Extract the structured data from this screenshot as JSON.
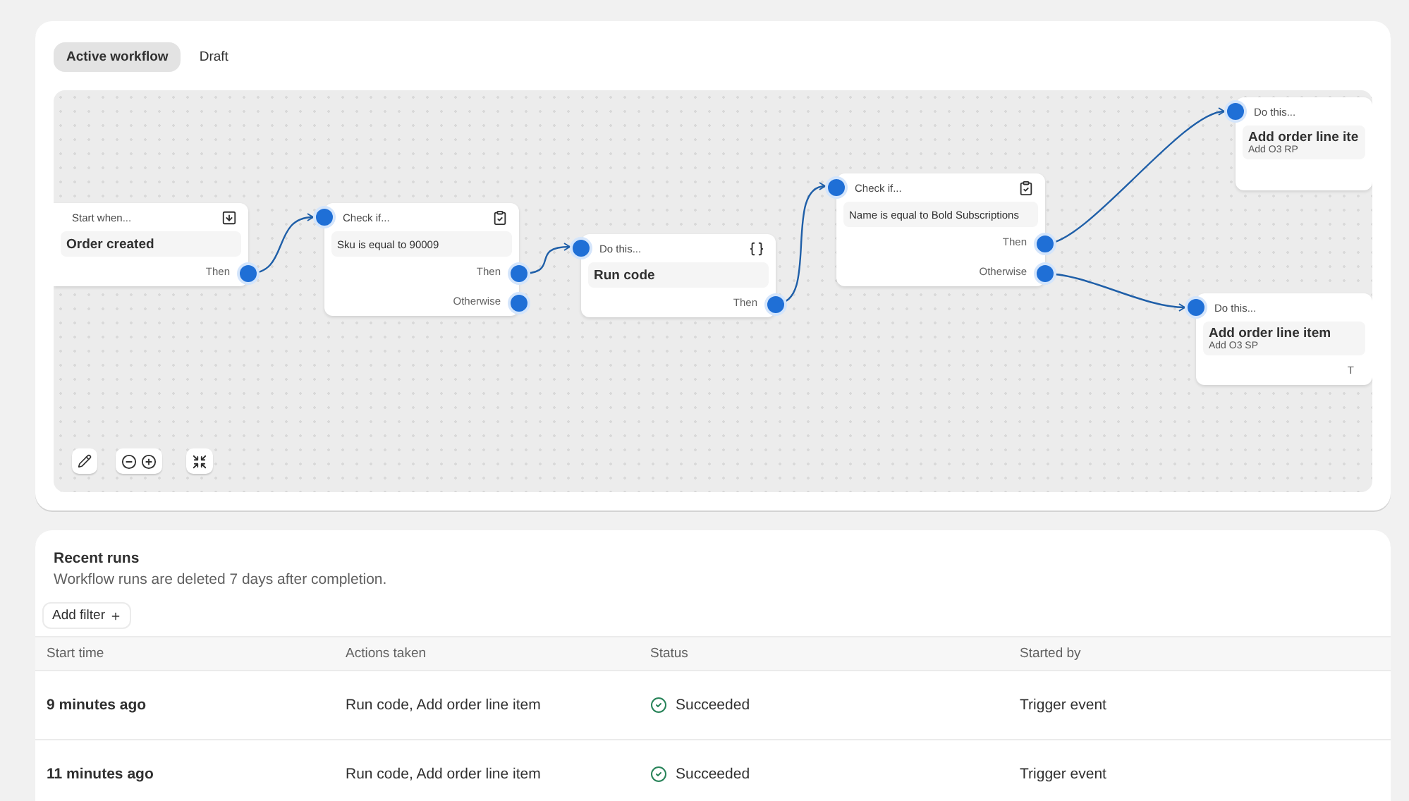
{
  "tabs": [
    {
      "label": "Active workflow",
      "selected": true
    },
    {
      "label": "Draft",
      "selected": false
    }
  ],
  "canvas": {
    "nodes": [
      {
        "kind": "trigger",
        "header": "Start when...",
        "title": "Order created",
        "outputs": [
          "Then"
        ]
      },
      {
        "kind": "condition",
        "header": "Check if...",
        "title": "Sku is equal to 90009",
        "outputs": [
          "Then",
          "Otherwise"
        ]
      },
      {
        "kind": "code",
        "header": "Do this...",
        "title": "Run code",
        "outputs": [
          "Then"
        ]
      },
      {
        "kind": "condition",
        "header": "Check if...",
        "title": "Name is equal to Bold Subscriptions",
        "outputs": [
          "Then",
          "Otherwise"
        ]
      },
      {
        "kind": "action",
        "header": "Do this...",
        "title": "Add order line ite",
        "subtitle": "Add O3 RP"
      },
      {
        "kind": "action",
        "header": "Do this...",
        "title": "Add order line item",
        "subtitle": "Add O3 SP",
        "outputs": [
          "T"
        ]
      }
    ]
  },
  "recent_runs": {
    "title": "Recent runs",
    "description": "Workflow runs are deleted 7 days after completion.",
    "filter_button": "Add filter",
    "columns": [
      "Start time",
      "Actions taken",
      "Status",
      "Started by"
    ],
    "rows": [
      {
        "start_time": "9 minutes ago",
        "actions": "Run code, Add order line item",
        "status": "Succeeded",
        "started_by": "Trigger event"
      },
      {
        "start_time": "11 minutes ago",
        "actions": "Run code, Add order line item",
        "status": "Succeeded",
        "started_by": "Trigger event"
      }
    ]
  }
}
